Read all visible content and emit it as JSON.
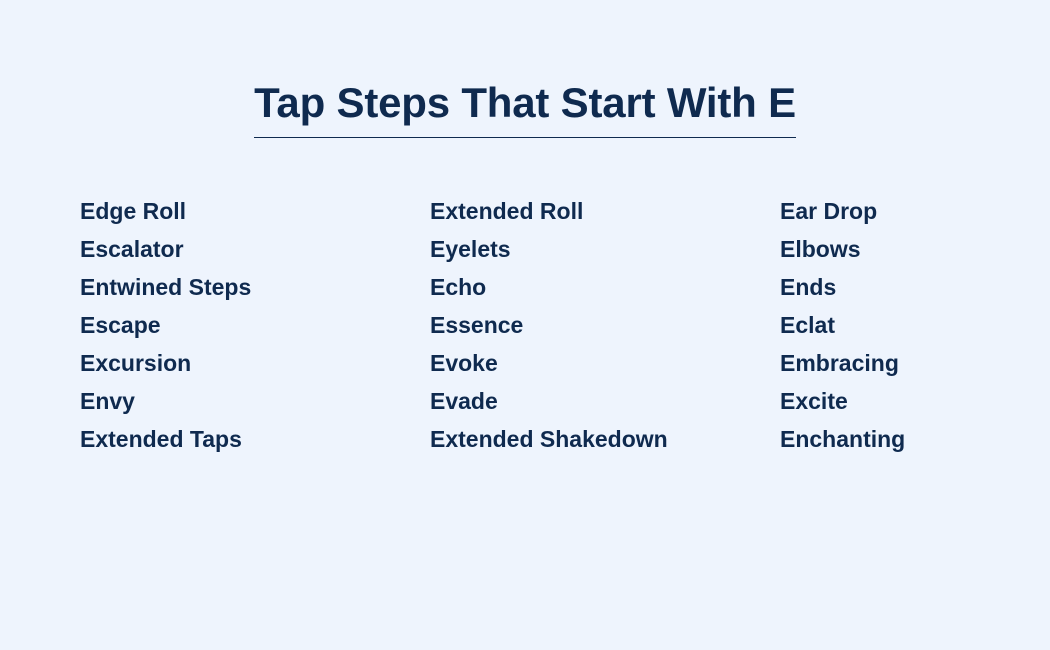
{
  "theme": {
    "background_color": "#eef4fd",
    "text_color": "#0f2a4f",
    "rule_color": "#0f2a4f"
  },
  "header": {
    "title": "Tap Steps That Start With E"
  },
  "list": {
    "columns": [
      {
        "items": [
          "Edge Roll",
          "Escalator",
          "Entwined Steps",
          "Escape",
          "Excursion",
          "Envy",
          "Extended Taps"
        ]
      },
      {
        "items": [
          "Extended Roll",
          "Eyelets",
          "Echo",
          "Essence",
          "Evoke",
          "Evade",
          "Extended Shakedown"
        ]
      },
      {
        "items": [
          "Ear Drop",
          "Elbows",
          "Ends",
          "Eclat",
          "Embracing",
          "Excite",
          "Enchanting"
        ]
      }
    ]
  }
}
